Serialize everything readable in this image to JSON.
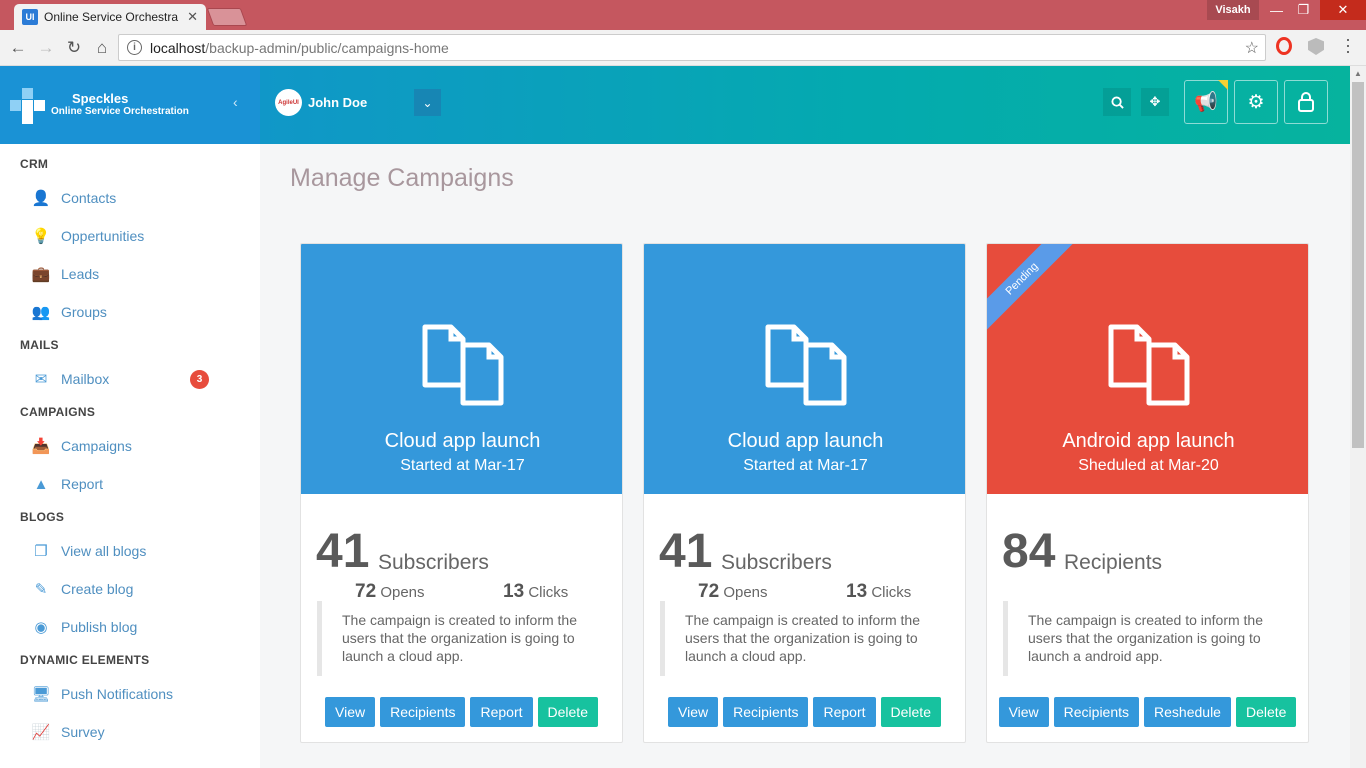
{
  "browser": {
    "tab_title": "Online Service Orchestra",
    "tab_favicon": "UI",
    "window_user": "Visakh",
    "url_host": "localhost",
    "url_path": "/backup-admin/public/campaigns-home"
  },
  "brand": {
    "name": "Speckles",
    "subtitle": "Online Service Orchestration"
  },
  "user": {
    "name": "John Doe",
    "avatar_text": "AgileUI"
  },
  "sidebar": {
    "sections": [
      {
        "title": "CRM",
        "items": [
          {
            "label": "Contacts",
            "icon": "user-icon"
          },
          {
            "label": "Oppertunities",
            "icon": "bulb-icon"
          },
          {
            "label": "Leads",
            "icon": "briefcase-icon"
          },
          {
            "label": "Groups",
            "icon": "users-icon"
          }
        ]
      },
      {
        "title": "MAILS",
        "items": [
          {
            "label": "Mailbox",
            "icon": "envelope-icon",
            "badge": "3"
          }
        ]
      },
      {
        "title": "CAMPAIGNS",
        "items": [
          {
            "label": "Campaigns",
            "icon": "inbox-icon"
          },
          {
            "label": "Report",
            "icon": "area-chart-icon"
          }
        ]
      },
      {
        "title": "BLOGS",
        "items": [
          {
            "label": "View all blogs",
            "icon": "copy-icon"
          },
          {
            "label": "Create blog",
            "icon": "edit-icon"
          },
          {
            "label": "Publish blog",
            "icon": "toggle-icon"
          }
        ]
      },
      {
        "title": "DYNAMIC ELEMENTS",
        "items": [
          {
            "label": "Push Notifications",
            "icon": "desktop-icon"
          },
          {
            "label": "Survey",
            "icon": "line-chart-icon"
          }
        ]
      }
    ]
  },
  "main": {
    "page_title": "Manage Campaigns",
    "cards": [
      {
        "title": "Cloud app launch",
        "subtitle": "Started at Mar-17",
        "color": "#3498db",
        "count": "41",
        "count_label": "Subscribers",
        "opens": "72",
        "opens_label": "Opens",
        "clicks": "13",
        "clicks_label": "Clicks",
        "description": "The campaign is created to inform the users that the organization is going to launch a cloud app.",
        "buttons": [
          "View",
          "Recipients",
          "Report",
          "Delete"
        ]
      },
      {
        "title": "Cloud app launch",
        "subtitle": "Started at Mar-17",
        "color": "#3498db",
        "count": "41",
        "count_label": "Subscribers",
        "opens": "72",
        "opens_label": "Opens",
        "clicks": "13",
        "clicks_label": "Clicks",
        "description": "The campaign is created to inform the users that the organization is going to launch a cloud app.",
        "buttons": [
          "View",
          "Recipients",
          "Report",
          "Delete"
        ]
      },
      {
        "title": "Android app launch",
        "subtitle": "Sheduled at Mar-20",
        "color": "#e74c3c",
        "ribbon": "Pending",
        "count": "84",
        "count_label": "Recipients",
        "description": "The campaign is created to inform the users that the organization is going to launch a android app.",
        "buttons": [
          "View",
          "Recipients",
          "Reshedule",
          "Delete"
        ]
      }
    ]
  }
}
